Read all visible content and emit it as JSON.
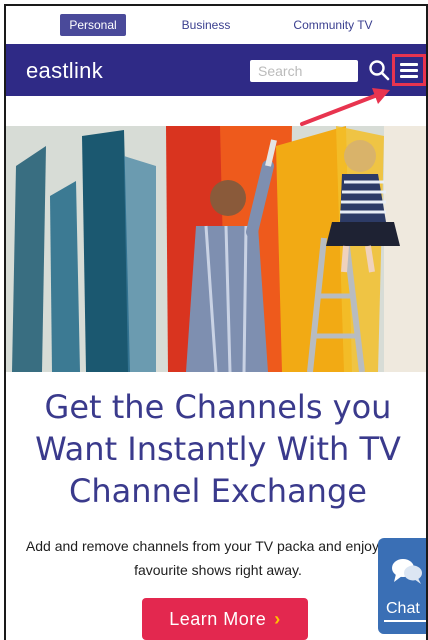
{
  "top_tabs": [
    {
      "label": "Personal",
      "active": true
    },
    {
      "label": "Business",
      "active": false
    },
    {
      "label": "Community TV",
      "active": false
    }
  ],
  "header": {
    "logo_text": "eastlink",
    "search_placeholder": "Search",
    "background": "#2f2a86",
    "highlight_color": "#e8344f"
  },
  "hero": {
    "headline": "Get the Channels you Want Instantly With TV Channel Exchange",
    "description": "Add and remove channels from your TV packa and enjoy your favourite shows right away.",
    "cta_label": "Learn More",
    "cta_chevron": "›",
    "cta_color": "#e3284f"
  },
  "chat": {
    "label": "Chat",
    "color": "#3a6fb5"
  },
  "icons": [
    "search-icon",
    "hamburger-menu-icon",
    "chat-bubbles-icon",
    "arrow-annotation"
  ]
}
